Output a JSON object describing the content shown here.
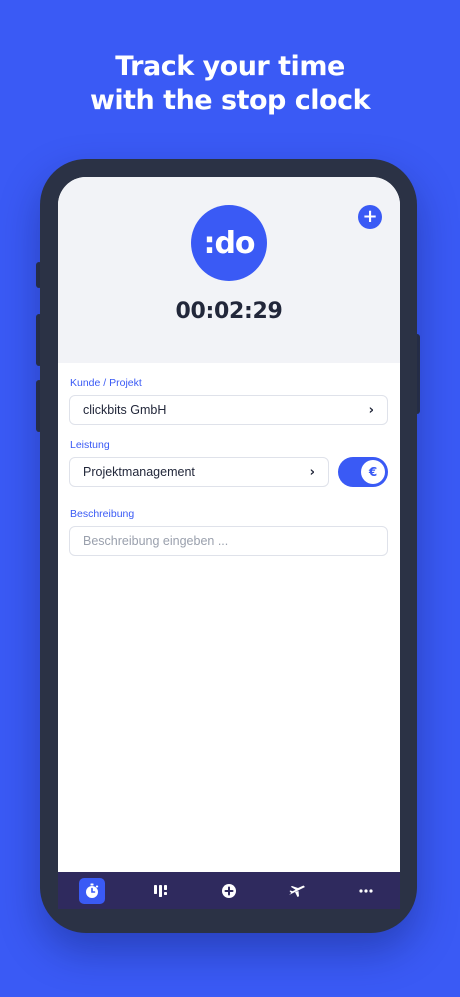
{
  "headline": {
    "line1": "Track your time",
    "line2": "with the stop clock"
  },
  "app": {
    "logo_text": ":do",
    "timer": "00:02:29"
  },
  "form": {
    "customer_label": "Kunde / Projekt",
    "customer_value": "clickbits GmbH",
    "service_label": "Leistung",
    "service_value": "Projektmanagement",
    "billable_toggle": {
      "on": true,
      "symbol": "€"
    },
    "description_label": "Beschreibung",
    "description_placeholder": "Beschreibung eingeben ..."
  },
  "tabbar": {
    "items": [
      {
        "icon": "stopwatch-icon",
        "active": true
      },
      {
        "icon": "dashboard-icon",
        "active": false
      },
      {
        "icon": "plus-circle-icon",
        "active": false
      },
      {
        "icon": "airplane-icon",
        "active": false
      },
      {
        "icon": "more-icon",
        "active": false
      }
    ]
  },
  "colors": {
    "brand_blue": "#3a5af5",
    "tabbar_bg": "#2f2a5e",
    "text_dark": "#22273a"
  }
}
